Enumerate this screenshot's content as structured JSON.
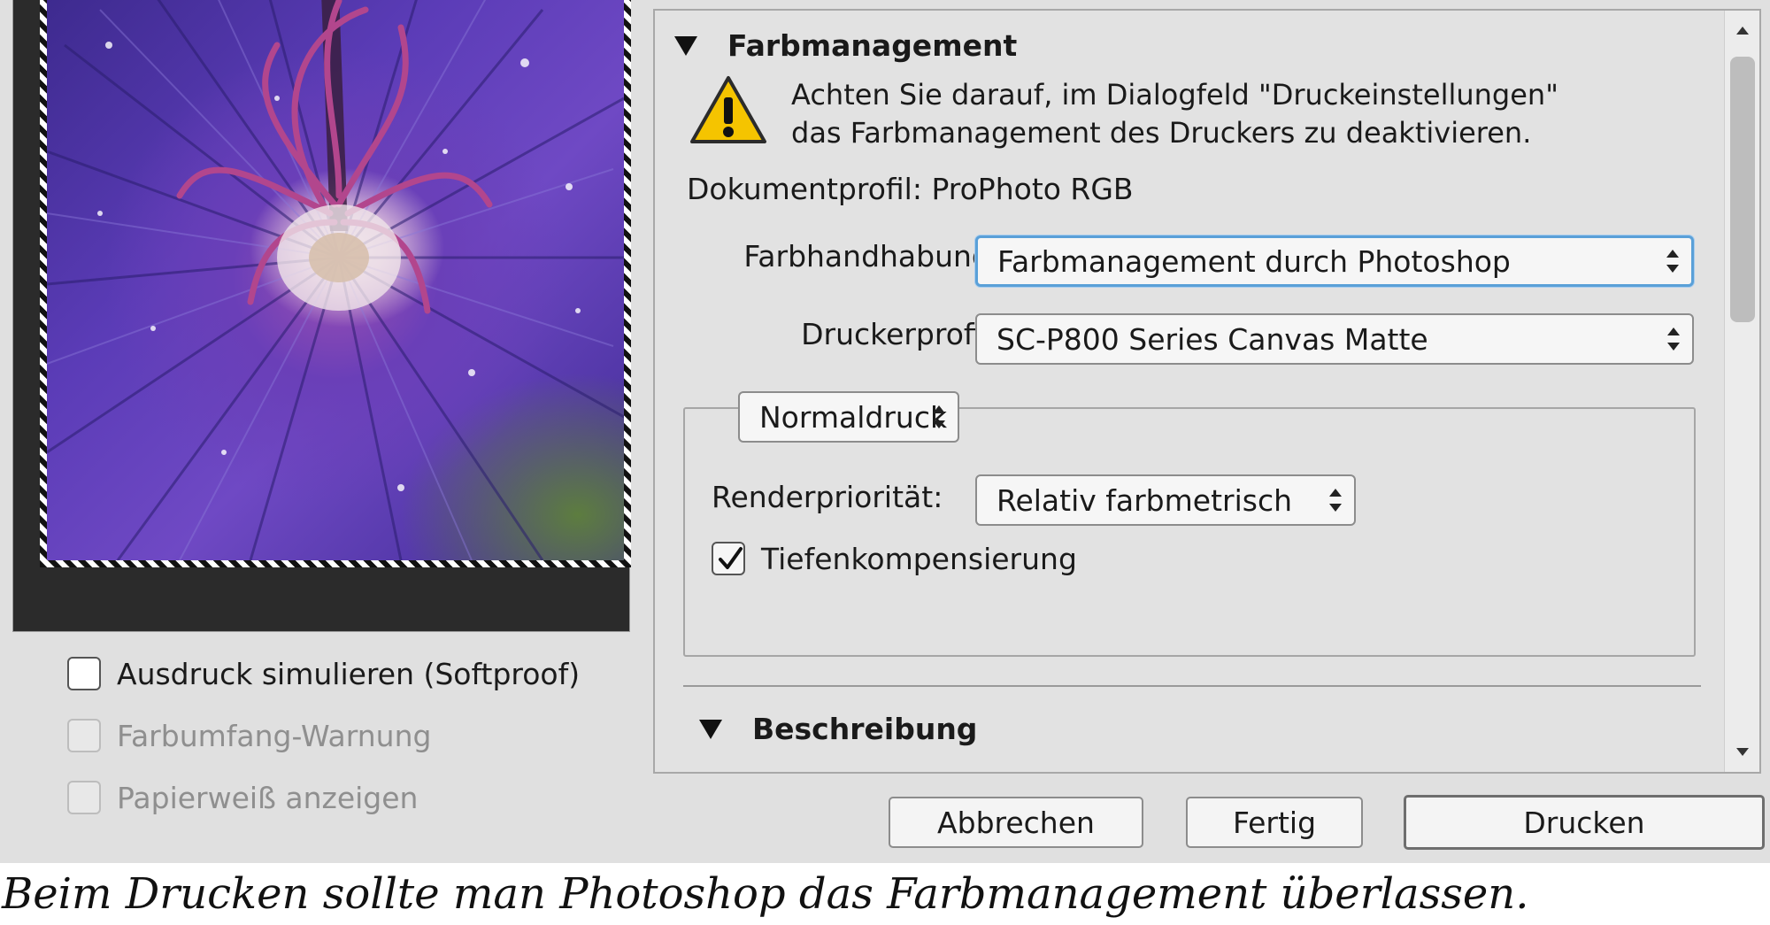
{
  "preview": {
    "image_alt": "Lila Blüte Makrofoto"
  },
  "proof_options": [
    {
      "label": "Ausdruck simulieren (Softproof)",
      "checked": false,
      "enabled": true
    },
    {
      "label": "Farbumfang-Warnung",
      "checked": false,
      "enabled": false
    },
    {
      "label": "Papierweiß anzeigen",
      "checked": false,
      "enabled": false
    }
  ],
  "color_management": {
    "section_title": "Farbmanagement",
    "warning_line1": "Achten Sie darauf, im Dialogfeld \"Druckeinstellungen\"",
    "warning_line2": "das Farbmanagement des Druckers zu deaktivieren.",
    "document_profile": "Dokumentprofil: ProPhoto RGB",
    "color_handling_label": "Farbhandhabung:",
    "color_handling_value": "Farbmanagement durch Photoshop",
    "printer_profile_label": "Druckerprofil:",
    "printer_profile_value": "SC-P800 Series Canvas Matte",
    "print_mode_value": "Normaldruck",
    "rendering_intent_label": "Renderpriorität:",
    "rendering_intent_value": "Relativ farbmetrisch",
    "black_point_label": "Tiefenkompensierung",
    "black_point_checked": true
  },
  "description_section": {
    "title": "Beschreibung"
  },
  "buttons": {
    "cancel": "Abbrechen",
    "done": "Fertig",
    "print": "Drucken"
  },
  "caption": "Beim Drucken sollte man Photoshop das Farbmanagement überlassen.",
  "colors": {
    "focus_ring": "#5aa0d8",
    "warning_yellow": "#f5c400",
    "panel_bg": "#e2e2e2"
  }
}
